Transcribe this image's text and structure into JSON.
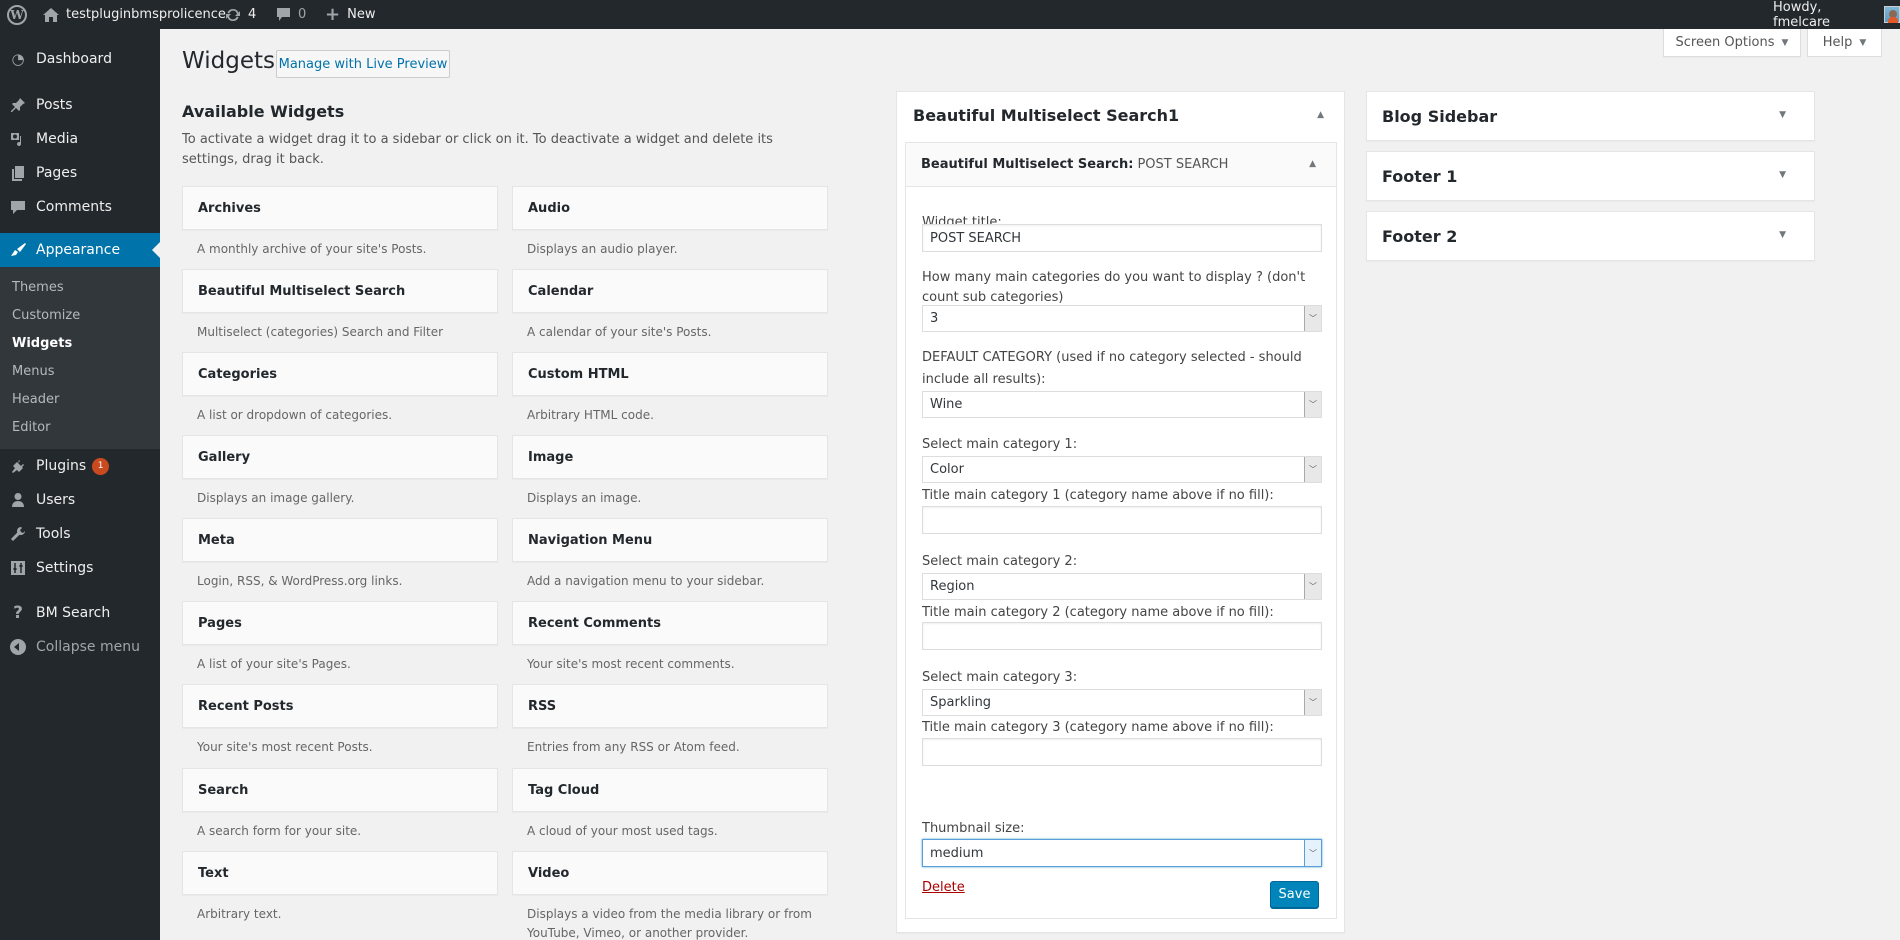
{
  "admin_bar": {
    "site_name": "testpluginbmsprolicence",
    "updates_count": "4",
    "comments_count": "0",
    "new_label": "New",
    "howdy": "Howdy, fmelcare"
  },
  "menu": {
    "items": [
      {
        "label": "Dashboard",
        "icon": "dashboard-icon"
      },
      {
        "label": "Posts",
        "icon": "pin-icon"
      },
      {
        "label": "Media",
        "icon": "media-icon"
      },
      {
        "label": "Pages",
        "icon": "pages-icon"
      },
      {
        "label": "Comments",
        "icon": "comment-icon"
      },
      {
        "label": "Appearance",
        "icon": "paintbrush-icon"
      },
      {
        "label": "Plugins",
        "icon": "plug-icon",
        "badge": "1"
      },
      {
        "label": "Users",
        "icon": "user-icon"
      },
      {
        "label": "Tools",
        "icon": "wrench-icon"
      },
      {
        "label": "Settings",
        "icon": "sliders-icon"
      },
      {
        "label": "BM Search",
        "icon": "question-icon"
      },
      {
        "label": "Collapse menu",
        "icon": "collapse-icon"
      }
    ],
    "submenu": [
      "Themes",
      "Customize",
      "Widgets",
      "Menus",
      "Header",
      "Editor"
    ],
    "current_submenu": "Widgets"
  },
  "header": {
    "screen_options": "Screen Options",
    "help": "Help",
    "title": "Widgets",
    "live_preview": "Manage with Live Preview"
  },
  "available": {
    "title": "Available Widgets",
    "description": "To activate a widget drag it to a sidebar or click on it. To deactivate a widget and delete its settings, drag it back.",
    "widgets": [
      {
        "name": "Archives",
        "desc": "A monthly archive of your site's Posts."
      },
      {
        "name": "Audio",
        "desc": "Displays an audio player."
      },
      {
        "name": "Beautiful Multiselect Search",
        "desc": "Multiselect (categories) Search and Filter"
      },
      {
        "name": "Calendar",
        "desc": "A calendar of your site's Posts."
      },
      {
        "name": "Categories",
        "desc": "A list or dropdown of categories."
      },
      {
        "name": "Custom HTML",
        "desc": "Arbitrary HTML code."
      },
      {
        "name": "Gallery",
        "desc": "Displays an image gallery."
      },
      {
        "name": "Image",
        "desc": "Displays an image."
      },
      {
        "name": "Meta",
        "desc": "Login, RSS, & WordPress.org links."
      },
      {
        "name": "Navigation Menu",
        "desc": "Add a navigation menu to your sidebar."
      },
      {
        "name": "Pages",
        "desc": "A list of your site's Pages."
      },
      {
        "name": "Recent Comments",
        "desc": "Your site's most recent comments."
      },
      {
        "name": "Recent Posts",
        "desc": "Your site's most recent Posts."
      },
      {
        "name": "RSS",
        "desc": "Entries from any RSS or Atom feed."
      },
      {
        "name": "Search",
        "desc": "A search form for your site."
      },
      {
        "name": "Tag Cloud",
        "desc": "A cloud of your most used tags."
      },
      {
        "name": "Text",
        "desc": "Arbitrary text."
      },
      {
        "name": "Video",
        "desc": "Displays a video from the media library or from YouTube, Vimeo, or another provider."
      }
    ]
  },
  "sidebar_area": {
    "title": "Beautiful Multiselect Search1",
    "widget": {
      "head_name": "Beautiful Multiselect Search:",
      "head_instance": "POST SEARCH",
      "fields": {
        "widget_title_label": "Widget title:",
        "widget_title_value": "POST SEARCH",
        "num_categories_label": "How many main categories do you want to display ? (don't count sub categories)",
        "num_categories_value": "3",
        "default_category_label": "DEFAULT CATEGORY (used if no category selected - should include all results):",
        "default_category_value": "Wine",
        "cat1_label": "Select main category 1:",
        "cat1_value": "Color",
        "cat1_title_label": "Title main category 1 (category name above if no fill):",
        "cat1_title_value": "",
        "cat2_label": "Select main category 2:",
        "cat2_value": "Region",
        "cat2_title_label": "Title main category 2 (category name above if no fill):",
        "cat2_title_value": "",
        "cat3_label": "Select main category 3:",
        "cat3_value": "Sparkling",
        "cat3_title_label": "Title main category 3 (category name above if no fill):",
        "cat3_title_value": "",
        "thumb_label": "Thumbnail size:",
        "thumb_value": "medium"
      },
      "delete_label": "Delete",
      "save_label": "Save"
    }
  },
  "other_sidebars": [
    "Blog Sidebar",
    "Footer 1",
    "Footer 2"
  ]
}
